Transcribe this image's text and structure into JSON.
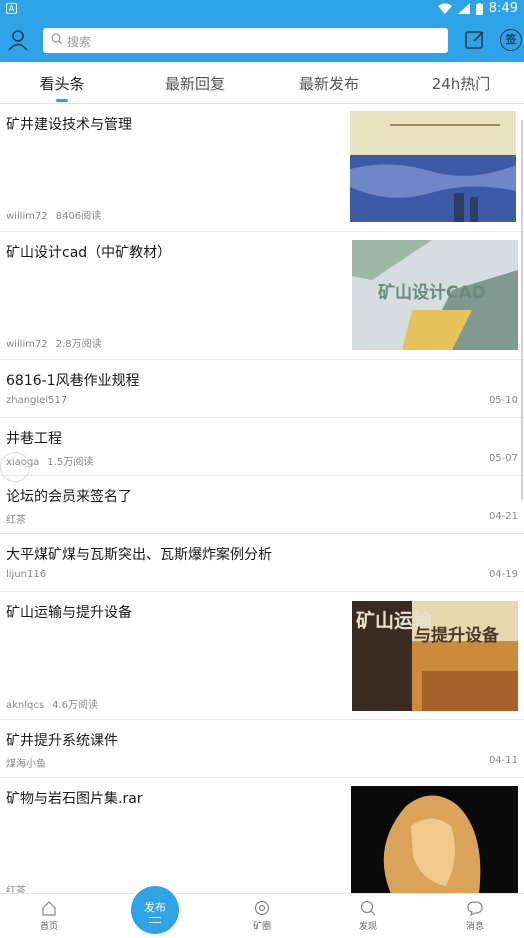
{
  "status": {
    "time": "8:49",
    "app_badge": "A"
  },
  "header": {
    "search_placeholder": "搜索",
    "sign_label": "签"
  },
  "tabs": [
    {
      "label": "看头条",
      "active": true
    },
    {
      "label": "最新回复",
      "active": false
    },
    {
      "label": "最新发布",
      "active": false
    },
    {
      "label": "24h热门",
      "active": false
    }
  ],
  "feed": [
    {
      "title": "矿井建设技术与管理",
      "author": "willim72",
      "reads": "8406阅读",
      "date": "",
      "thumb": "book-blue"
    },
    {
      "title": "矿山设计cad（中矿教材）",
      "author": "willim72",
      "reads": "2.8万阅读",
      "date": "",
      "thumb": "book-cad"
    },
    {
      "title": "6816-1风巷作业规程",
      "author": "zhanglei517",
      "reads": "",
      "date": "05-10",
      "thumb": ""
    },
    {
      "title": "井巷工程",
      "author": "xiaoga",
      "reads": "1.5万阅读",
      "date": "05-07",
      "thumb": ""
    },
    {
      "title": "论坛的会员来签名了",
      "author": "红茶",
      "reads": "",
      "date": "04-21",
      "thumb": ""
    },
    {
      "title": "大平煤矿煤与瓦斯突出、瓦斯爆炸案例分析",
      "author": "lijun116",
      "reads": "",
      "date": "04-19",
      "thumb": ""
    },
    {
      "title": "矿山运输与提升设备",
      "author": "aknlqcs",
      "reads": "4.6万阅读",
      "date": "",
      "thumb": "book-transport"
    },
    {
      "title": "矿井提升系统课件",
      "author": "煤海小鱼",
      "reads": "",
      "date": "04-11",
      "thumb": ""
    },
    {
      "title": "矿物与岩石图片集.rar",
      "author": "红茶",
      "reads": "",
      "date": "",
      "thumb": "rock"
    }
  ],
  "thumb_text": {
    "book_cad": "矿山设计CAD",
    "book_transport_1": "矿山运输",
    "book_transport_2": "与提升设备"
  },
  "publish_button": "发布",
  "bottom_nav": [
    {
      "label": "首页",
      "icon": "home-icon"
    },
    {
      "label": "矿圈",
      "icon": "circle-icon"
    },
    {
      "label": "发现",
      "icon": "discover-icon"
    },
    {
      "label": "消息",
      "icon": "message-icon"
    }
  ],
  "colors": {
    "accent": "#2ea3e8"
  }
}
